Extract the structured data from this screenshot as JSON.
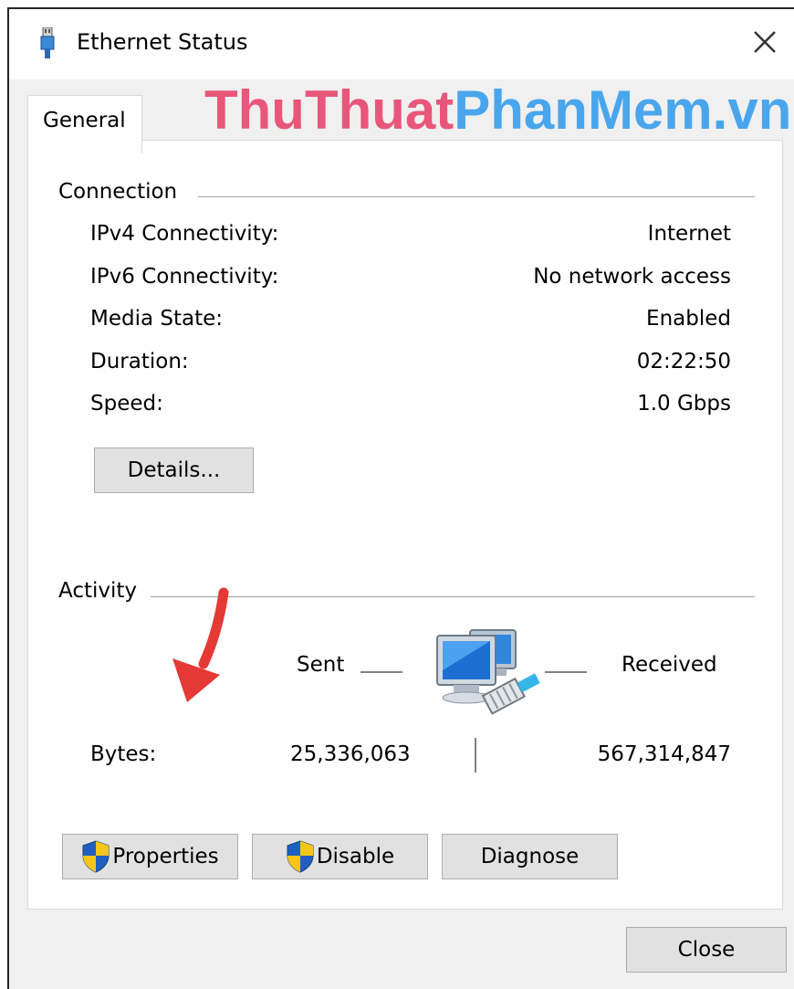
{
  "window": {
    "title": "Ethernet Status"
  },
  "tabs": [
    {
      "label": "General"
    }
  ],
  "watermark": {
    "part1": "ThuThuat",
    "part2": "PhanMem.vn"
  },
  "connection": {
    "heading": "Connection",
    "rows": [
      {
        "label": "IPv4 Connectivity:",
        "value": "Internet"
      },
      {
        "label": "IPv6 Connectivity:",
        "value": "No network access"
      },
      {
        "label": "Media State:",
        "value": "Enabled"
      },
      {
        "label": "Duration:",
        "value": "02:22:50"
      },
      {
        "label": "Speed:",
        "value": "1.0 Gbps"
      }
    ],
    "details_button": "Details..."
  },
  "activity": {
    "heading": "Activity",
    "sent_label": "Sent",
    "received_label": "Received",
    "bytes_label": "Bytes:",
    "bytes_sent": "25,336,063",
    "bytes_received": "567,314,847"
  },
  "buttons": {
    "properties": "Properties",
    "disable": "Disable",
    "diagnose": "Diagnose",
    "close": "Close"
  },
  "colors": {
    "watermark_pink": "#e8577a",
    "watermark_blue": "#4aa6ec",
    "arrow_red": "#e53935",
    "shield_blue": "#1f5fbf",
    "shield_yellow": "#f5c518"
  },
  "icons": [
    "ethernet-plug-icon",
    "close-icon",
    "network-computers-icon",
    "uac-shield-icon",
    "red-arrow-annotation"
  ]
}
